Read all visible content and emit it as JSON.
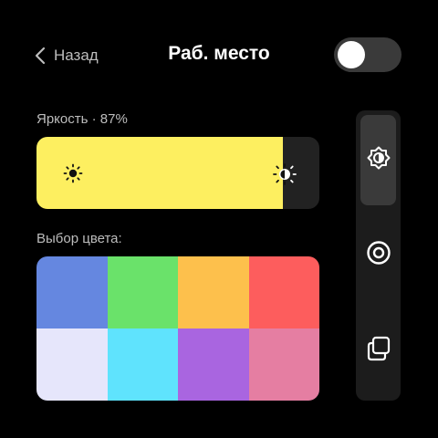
{
  "header": {
    "back_label": "Назад",
    "title": "Раб. место",
    "toggle_on": false
  },
  "brightness": {
    "label": "Яркость · 87%",
    "value_percent": 87,
    "fill_color": "#fdef60",
    "low_icon": "sun-low-icon",
    "high_icon": "sun-high-icon"
  },
  "colors": {
    "label": "Выбор цвета:",
    "swatches": [
      "#6587e0",
      "#6ae26a",
      "#fdc04c",
      "#fd5d5d",
      "#e6e6fb",
      "#5fe3fd",
      "#a965e0",
      "#e57ea2"
    ]
  },
  "side_panel": {
    "buttons": [
      "brightness-mode-icon",
      "target-icon",
      "copy-icon"
    ],
    "active": 0
  }
}
